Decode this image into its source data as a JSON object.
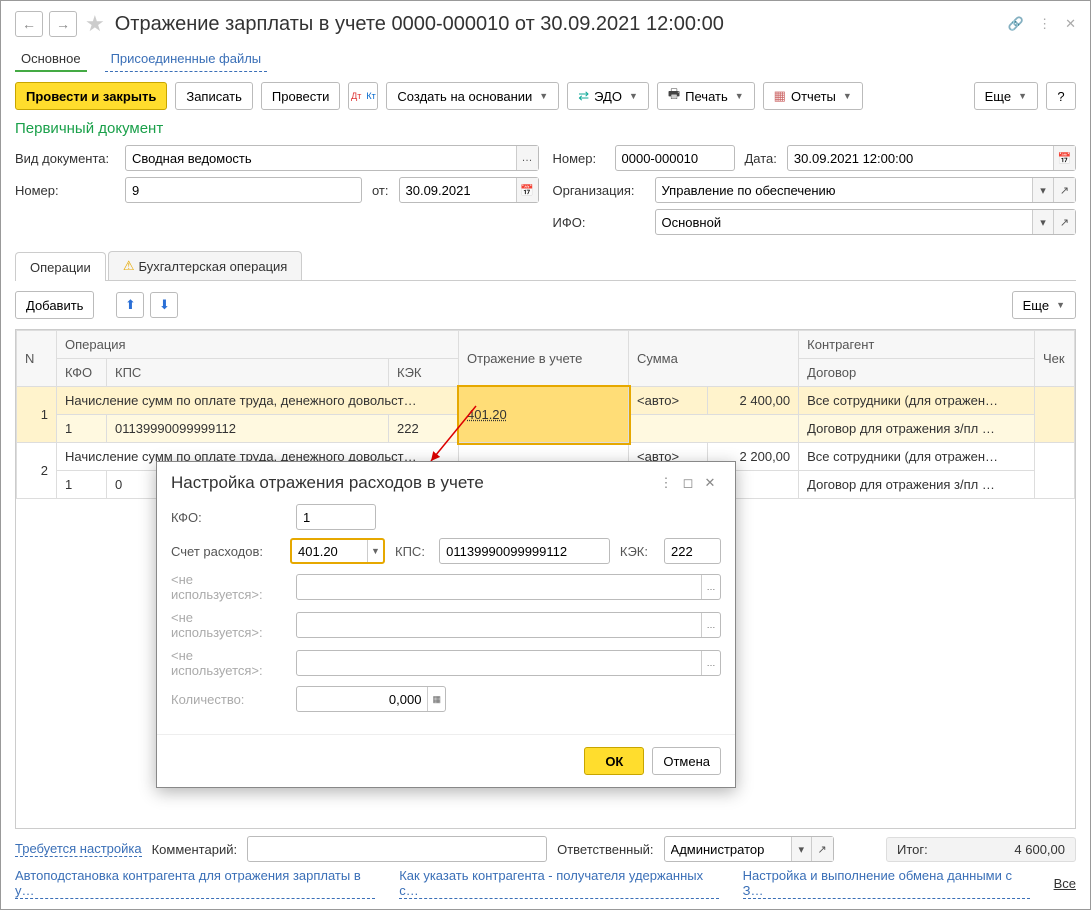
{
  "header": {
    "title": "Отражение зарплаты в учете 0000-000010 от 30.09.2021 12:00:00"
  },
  "main_tabs": {
    "main": "Основное",
    "files": "Присоединенные файлы"
  },
  "toolbar": {
    "post_close": "Провести и закрыть",
    "save": "Записать",
    "post": "Провести",
    "create_based": "Создать на основании",
    "edo": "ЭДО",
    "print": "Печать",
    "reports": "Отчеты",
    "more": "Еще",
    "help": "?"
  },
  "section": {
    "title": "Первичный документ",
    "doc_type_label": "Вид документа:",
    "doc_type_value": "Сводная ведомость",
    "number_label": "Номер:",
    "reg_number_value": "0000-000010",
    "date_label": "Дата:",
    "date_value": "30.09.2021 12:00:00",
    "number2_label": "Номер:",
    "number2_value": "9",
    "from_label": "от:",
    "from_value": "30.09.2021",
    "org_label": "Организация:",
    "org_value": "Управление по обеспечению",
    "ifo_label": "ИФО:",
    "ifo_value": "Основной"
  },
  "subtabs": {
    "operations": "Операции",
    "accounting": "Бухгалтерская операция"
  },
  "table_toolbar": {
    "add": "Добавить",
    "more": "Еще"
  },
  "table": {
    "headers": {
      "n": "N",
      "operation": "Операция",
      "reflection": "Отражение в учете",
      "sum": "Сумма",
      "counterparty": "Контрагент",
      "check": "Чек",
      "kfo": "КФО",
      "kps": "КПС",
      "kek": "КЭК",
      "contract": "Договор"
    },
    "rows": [
      {
        "n": "1",
        "operation": "Начисление сумм по оплате труда, денежного довольст…",
        "reflection": "401.20",
        "sum_auto": "<авто>",
        "sum": "2 400,00",
        "counterparty": "Все сотрудники (для отражен…",
        "kfo": "1",
        "kps": "01139990099999112",
        "kek": "222",
        "contract": "Договор для отражения з/пл …"
      },
      {
        "n": "2",
        "operation": "Начисление сумм по оплате труда, денежного довольст…",
        "reflection": "401.20",
        "sum_auto": "<авто>",
        "sum": "2 200,00",
        "counterparty": "Все сотрудники (для отражен…",
        "kfo": "1",
        "kps": "0",
        "kek": "",
        "contract": "Договор для отражения з/пл …"
      }
    ]
  },
  "dialog": {
    "title": "Настройка отражения расходов в учете",
    "kfo_label": "КФО:",
    "kfo_value": "1",
    "account_label": "Счет расходов:",
    "account_value": "401.20",
    "kps_label": "КПС:",
    "kps_value": "01139990099999112",
    "kek_label": "КЭК:",
    "kek_value": "222",
    "unused": "<не используется>:",
    "qty_label": "Количество:",
    "qty_value": "0,000",
    "ok": "ОК",
    "cancel": "Отмена"
  },
  "footer": {
    "need_setup": "Требуется настройка",
    "comment_label": "Комментарий:",
    "responsible_label": "Ответственный:",
    "responsible_value": "Администратор",
    "total_label": "Итог:",
    "total_value": "4 600,00",
    "link1": "Автоподстановка контрагента для отражения зарплаты в у…",
    "link2": "Как указать контрагента - получателя удержанных с…",
    "link3": "Настройка и выполнение обмена данными с З…",
    "all": "Все"
  }
}
